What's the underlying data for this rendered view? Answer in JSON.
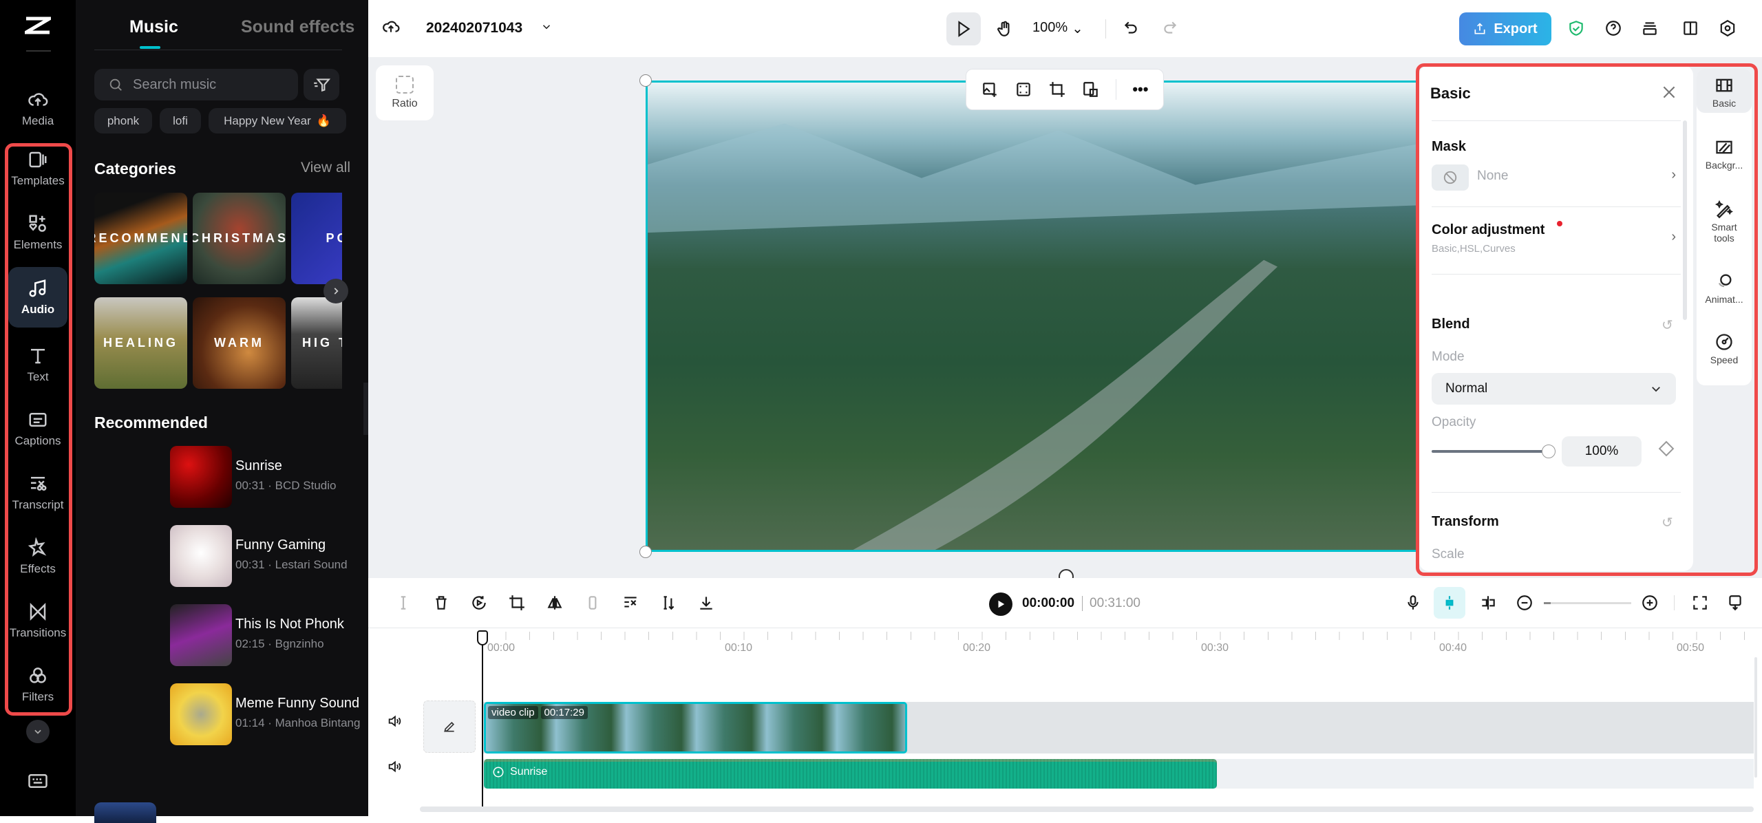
{
  "rail": {
    "items": [
      {
        "label": "Media",
        "icon": "cloud-upload-icon"
      },
      {
        "label": "Templates",
        "icon": "templates-icon"
      },
      {
        "label": "Elements",
        "icon": "elements-icon"
      },
      {
        "label": "Audio",
        "icon": "music-note-icon",
        "active": true
      },
      {
        "label": "Text",
        "icon": "text-icon"
      },
      {
        "label": "Captions",
        "icon": "captions-icon"
      },
      {
        "label": "Transcript",
        "icon": "transcript-icon"
      },
      {
        "label": "Effects",
        "icon": "effects-icon"
      },
      {
        "label": "Transitions",
        "icon": "transitions-icon"
      },
      {
        "label": "Filters",
        "icon": "filters-icon"
      }
    ]
  },
  "panel": {
    "tabs": [
      "Music",
      "Sound effects"
    ],
    "search_placeholder": "Search music",
    "chips": [
      "phonk",
      "lofi",
      "Happy New Year"
    ],
    "categories_title": "Categories",
    "view_all": "View all",
    "categories": [
      "RECOMMEND",
      "CHRISTMAS",
      "PO",
      "HEALING",
      "WARM",
      "HIG TEM"
    ],
    "recommended_title": "Recommended",
    "tracks": [
      {
        "title": "Sunrise",
        "meta": "00:31 · BCD Studio"
      },
      {
        "title": "Funny Gaming",
        "meta": "00:31 · Lestari Sound"
      },
      {
        "title": "This Is Not Phonk",
        "meta": "02:15 · Bgnzinho"
      },
      {
        "title": "Meme Funny Sound",
        "meta": "01:14 · Manhoa Bintang"
      }
    ]
  },
  "topbar": {
    "project": "202402071043",
    "zoom": "100%",
    "export": "Export"
  },
  "canvas": {
    "ratio": "Ratio"
  },
  "props": {
    "title": "Basic",
    "mask": "Mask",
    "mask_value": "None",
    "color_adj": "Color adjustment",
    "color_adj_sub": "Basic,HSL,Curves",
    "blend": "Blend",
    "mode_label": "Mode",
    "mode_value": "Normal",
    "opacity_label": "Opacity",
    "opacity_value": "100%",
    "opacity": 1.0,
    "transform": "Transform",
    "scale": "Scale",
    "side_tabs": [
      "Basic",
      "Backgr...",
      "Smart tools",
      "Animat...",
      "Speed"
    ]
  },
  "timeline": {
    "current": "00:00:00",
    "total": "00:31:00",
    "ticks": [
      "00:00",
      "00:10",
      "00:20",
      "00:30",
      "00:40",
      "00:50"
    ],
    "video_clip": {
      "label": "video clip",
      "duration": "00:17:29"
    },
    "audio_clip": {
      "label": "Sunrise"
    }
  },
  "colors": {
    "accent": "#00c1cd",
    "export": "#3b8ee6",
    "audio": "#13b08a",
    "highlight": "#ef4a4a"
  }
}
